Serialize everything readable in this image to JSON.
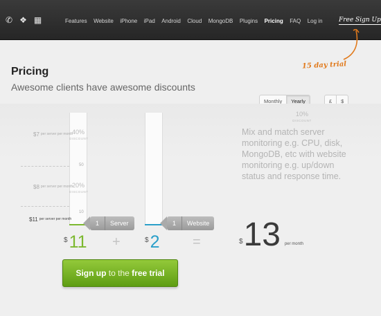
{
  "nav": {
    "icons": [
      "phone-icon",
      "chat-icon",
      "map-icon"
    ],
    "items": [
      "Features",
      "Website",
      "iPhone",
      "iPad",
      "Android",
      "Cloud",
      "MongoDB",
      "Plugins",
      "Pricing",
      "FAQ",
      "Log in"
    ],
    "active": "Pricing",
    "signup_label": "Free Sign Up"
  },
  "header": {
    "title": "Pricing",
    "subtitle": "Awesome clients have awesome discounts",
    "trial_note": "15 day trial"
  },
  "billing_toggle": {
    "options": [
      "Monthly",
      "Yearly"
    ],
    "selected": "Yearly"
  },
  "currency_toggle": {
    "options": [
      "£",
      "$"
    ]
  },
  "server_slider": {
    "tiers": [
      {
        "price": "7",
        "per": "per server per month",
        "discount": "40%"
      },
      {
        "price": "8",
        "per": "per server per month",
        "discount": "20%"
      },
      {
        "price": "11",
        "per": "per server per month",
        "discount": ""
      }
    ],
    "ticks": [
      "50",
      "10"
    ],
    "discount_label": "DISCOUNT",
    "handle_count": "1",
    "handle_label": "Server",
    "currency_symbol": "$",
    "subtotal": "11",
    "accent": "#7cb82f"
  },
  "website_slider": {
    "discount": "10%",
    "discount_label": "DISCOUNT",
    "handle_count": "1",
    "handle_label": "Website",
    "currency_symbol": "$",
    "subtotal": "2",
    "accent": "#2a9fc9"
  },
  "operators": {
    "plus": "+",
    "equals": "="
  },
  "description": "Mix and match server monitoring e.g. CPU, disk, MongoDB, etc with website monitoring e.g. up/down status and response time.",
  "total": {
    "currency_symbol": "$",
    "amount": "13",
    "per": "per month"
  },
  "cta": {
    "bold": "Sign up",
    "middle": "to the",
    "bold2": "free trial"
  }
}
